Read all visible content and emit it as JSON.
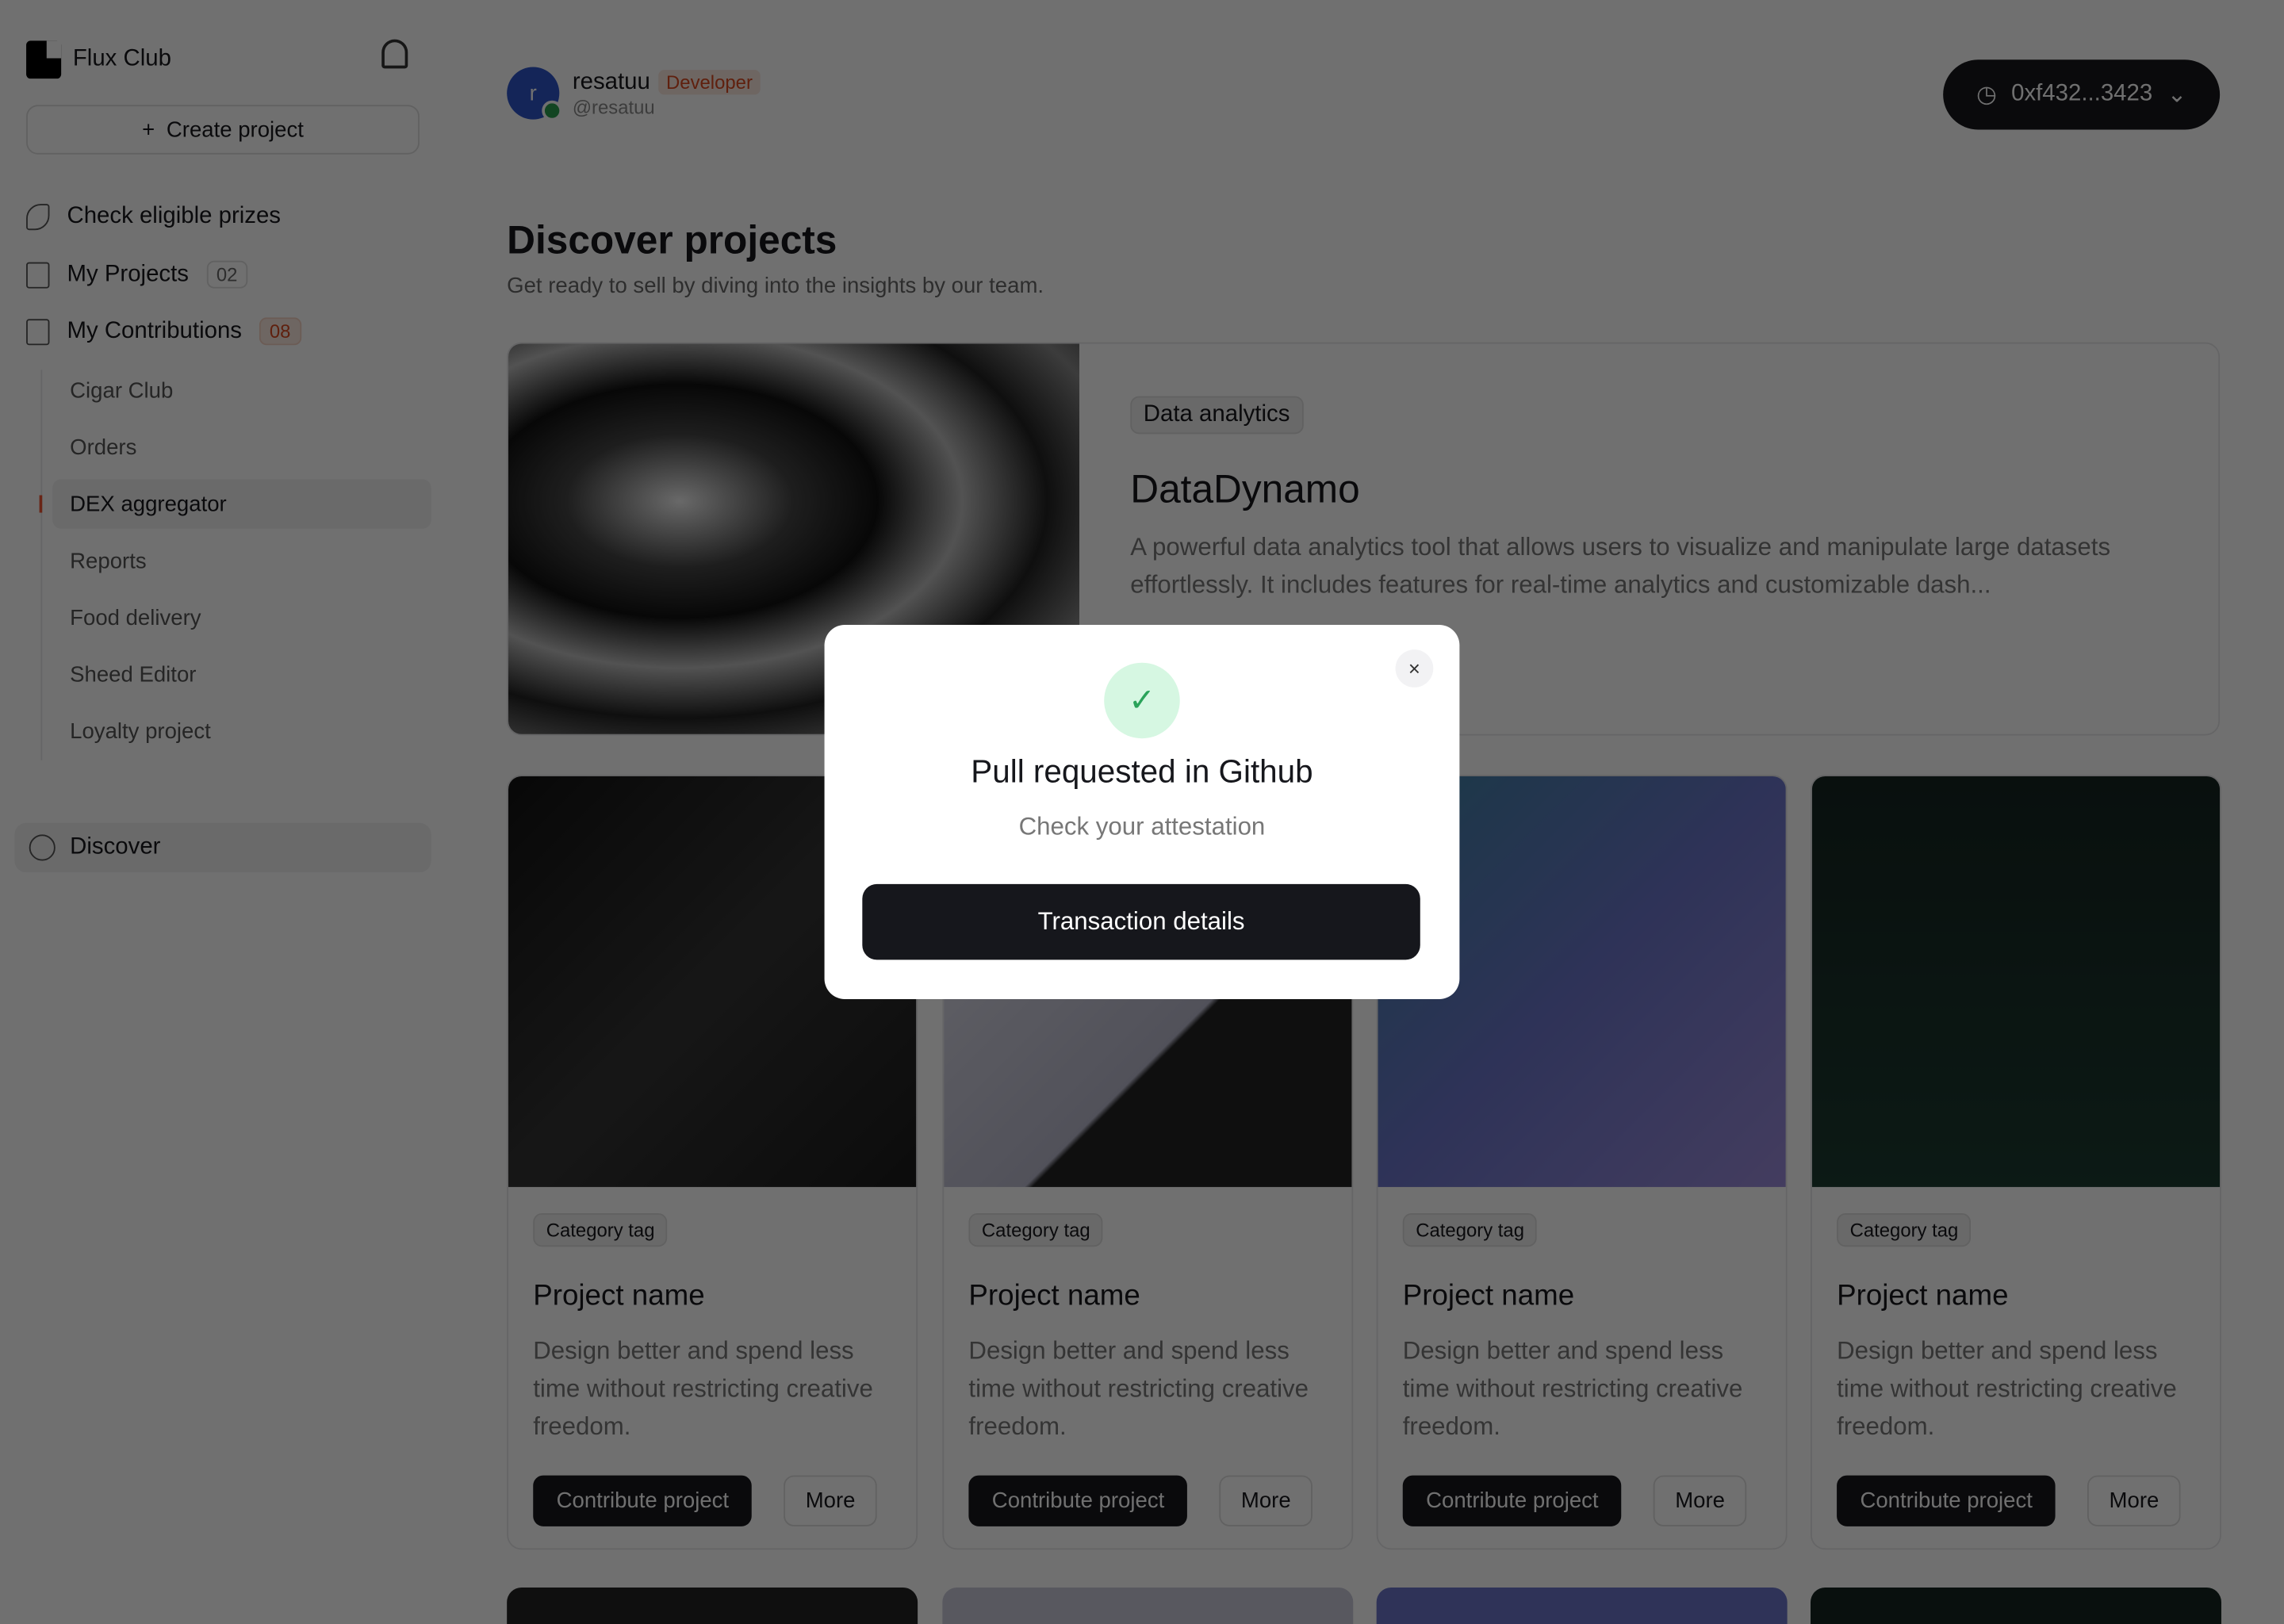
{
  "sidebar": {
    "brand": "Flux Club",
    "create_label": "Create project",
    "nav": [
      {
        "label": "Check eligible prizes",
        "icon": "feather-icon"
      },
      {
        "label": "My Projects",
        "badge": "02",
        "icon": "document-icon"
      },
      {
        "label": "My Contributions",
        "badge": "08",
        "icon": "file-icon"
      }
    ],
    "contributions": [
      "Cigar Club",
      "Orders",
      "DEX aggregator",
      "Reports",
      "Food delivery",
      "Sheed Editor",
      "Loyalty project"
    ],
    "active_item": "DEX aggregator",
    "discover": "Discover"
  },
  "header": {
    "avatar_letter": "r",
    "username": "resatuu",
    "role": "Developer",
    "handle": "@resatuu",
    "wallet": "0xf432...3423"
  },
  "main": {
    "title": "Discover projects",
    "subtitle": "Get ready to sell by diving into the insights by our team.",
    "featured": {
      "tag": "Data analytics",
      "title": "DataDynamo",
      "description": "A powerful data analytics tool that allows users to visualize and manipulate large datasets effortlessly. It includes features for real-time analytics and customizable dash..."
    },
    "cards": [
      {
        "tag": "Category tag",
        "title": "Project name",
        "description": "Design better and spend less time without restricting creative freedom.",
        "primary": "Contribute project",
        "secondary": "More"
      },
      {
        "tag": "Category tag",
        "title": "Project name",
        "description": "Design better and spend less time without restricting creative freedom.",
        "primary": "Contribute project",
        "secondary": "More"
      },
      {
        "tag": "Category tag",
        "title": "Project name",
        "description": "Design better and spend less time without restricting creative freedom.",
        "primary": "Contribute project",
        "secondary": "More"
      },
      {
        "tag": "Category tag",
        "title": "Project name",
        "description": "Design better and spend less time without restricting creative freedom.",
        "primary": "Contribute project",
        "secondary": "More"
      }
    ]
  },
  "modal": {
    "title": "Pull requested in Github",
    "subtitle": "Check your attestation",
    "button": "Transaction details",
    "close": "×",
    "check": "✓"
  },
  "colors": {
    "accent": "#16171c",
    "badge_red": "#d9481f",
    "success": "#2aa35a"
  }
}
